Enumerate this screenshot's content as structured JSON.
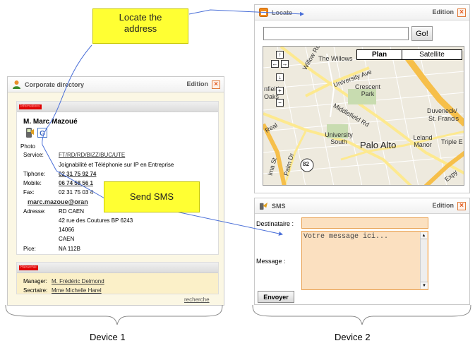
{
  "annotations": {
    "locate_callout": "Locate the address",
    "sms_callout": "Send SMS",
    "device1": "Device 1",
    "device2": "Device 2"
  },
  "directory": {
    "title": "Corporate directory",
    "edition": "Edition",
    "close": "×",
    "section1_tag": "Informations",
    "name": "M. Marc Mazoué",
    "photo_label": "Photo",
    "service_label": "Service:",
    "service_value": "FT/RD/RD/BIZZ/BUC/UTE",
    "service_desc": "Joignabilité et Téléphonie sur IP en Entreprise",
    "phone_label": "Tlphone:",
    "phone_value": "02 31 75 92 74",
    "mobile_label": "Mobile:",
    "mobile_value": "06 74 58 56 1",
    "fax_label": "Fax:",
    "fax_value": "02 31 75 03 4",
    "email": "marc.mazoue@oran",
    "address_label": "Adresse:",
    "address_lines": [
      "RD CAEN",
      "42 rue des Coutures BP 6243",
      "14066",
      "CAEN"
    ],
    "room_label": "Pice:",
    "room_value": "NA 112B",
    "section2_tag": "Hiérarchie",
    "manager_label": "Manager:",
    "manager_value": "M. Frédéric Delmond",
    "secretary_label": "Secrtaire:",
    "secretary_value": "Mme Michelle Harel",
    "search_link": "recherche"
  },
  "locate": {
    "title": "Locate",
    "edition": "Edition",
    "close": "×",
    "input_value": "",
    "go_label": "Go!",
    "map_type_plan": "Plan",
    "map_type_satellite": "Satellite",
    "nav": {
      "up": "↑",
      "left": "←",
      "right": "→",
      "down": "↓",
      "zoom_in": "+",
      "zoom_out": "−"
    },
    "map_labels": {
      "willows": "The Willows",
      "university_ave": "University Ave",
      "crescent_park": "Crescent Park",
      "duveneck": "Duveneck/",
      "st_francis": "St. Francis",
      "middlefield": "Middlefield Rd",
      "university_south": "University South",
      "palo_alto": "Palo Alto",
      "leland_manor": "Leland Manor",
      "triple_e": "Triple E",
      "route": "82",
      "willow_rd": "Willow Ro",
      "palm_dr": "Palm Dr",
      "nfield": "nfield",
      "oaks": "Oaks",
      "real": "Real",
      "lma_st": "lma St",
      "expy": "Expy"
    }
  },
  "sms": {
    "title": "SMS",
    "edition": "Edition",
    "close": "×",
    "recipient_label": "Destinataire :",
    "recipient_value": "",
    "message_label": "Message :",
    "message_placeholder": "Votre message ici...",
    "send_label": "Envoyer"
  },
  "colors": {
    "callout": "#ffff33",
    "red_tag": "#e00000",
    "map_bg": "#eeeade",
    "highway": "#f6bf4a",
    "road": "#fde98f",
    "input_orange": "#f5c07a"
  }
}
